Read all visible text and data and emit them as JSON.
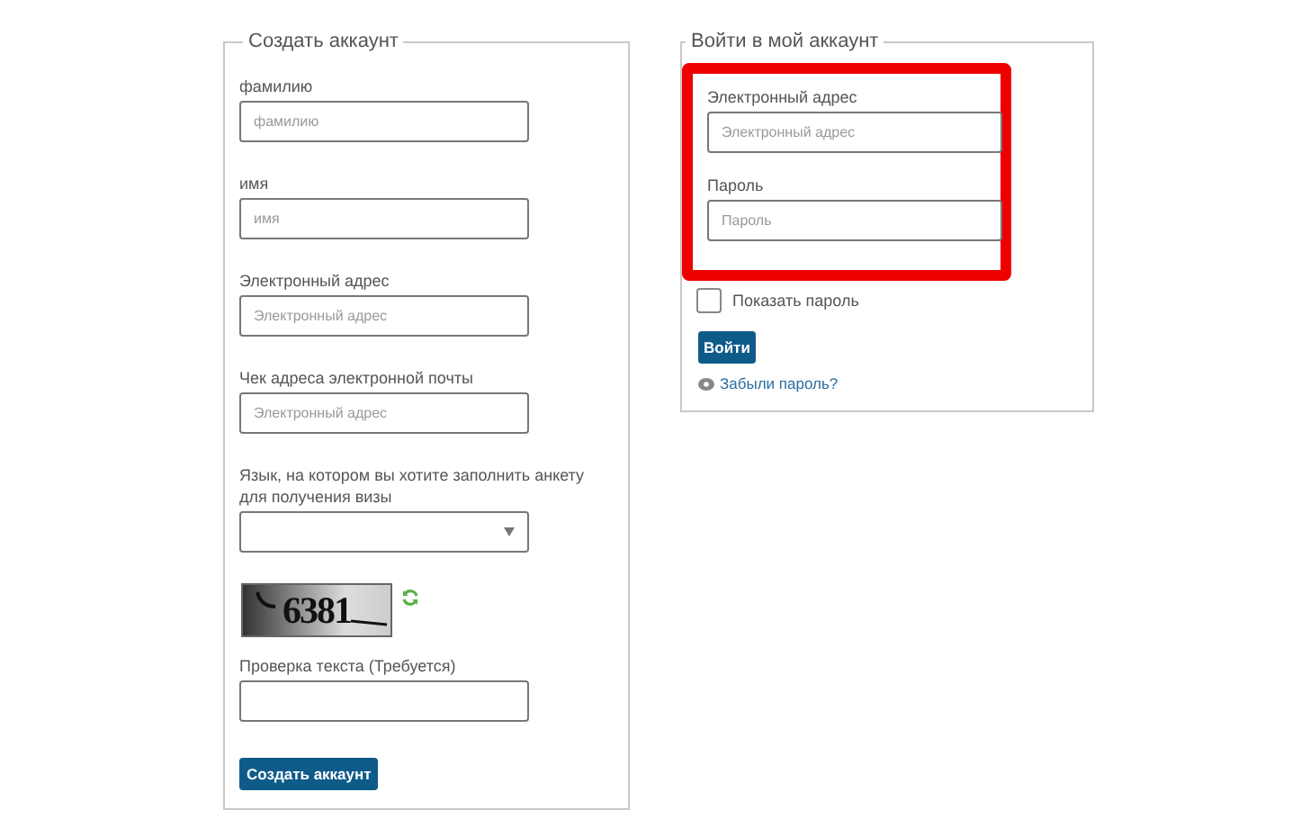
{
  "create_account": {
    "title": "Создать аккаунт",
    "fields": [
      {
        "kind": "text",
        "label": "фамилию",
        "placeholder": "фамилию"
      },
      {
        "kind": "text",
        "label": "имя",
        "placeholder": "имя"
      },
      {
        "kind": "text",
        "label": "Электронный адрес",
        "placeholder": "Электронный адрес"
      },
      {
        "kind": "text",
        "label": "Чек адреса электронной почты",
        "placeholder": "Электронный адрес"
      },
      {
        "kind": "select",
        "label": "Язык, на котором вы хотите заполнить анкету для получения визы"
      },
      {
        "kind": "captcha",
        "captcha": "6381"
      },
      {
        "kind": "text",
        "label": "Проверка текста (Требуется)"
      }
    ],
    "button": "Создать аккаунт"
  },
  "login": {
    "title": "Войти в мой аккаунт",
    "highlighted": true,
    "fields": [
      {
        "label": "Электронный адрес",
        "placeholder": "Электронный адрес"
      },
      {
        "label": "Пароль",
        "placeholder": "Пароль"
      }
    ],
    "show_password": {
      "label": "Показать пароль",
      "checked": false
    },
    "button": "Войти",
    "forgot_link": "Забыли пароль?"
  }
}
